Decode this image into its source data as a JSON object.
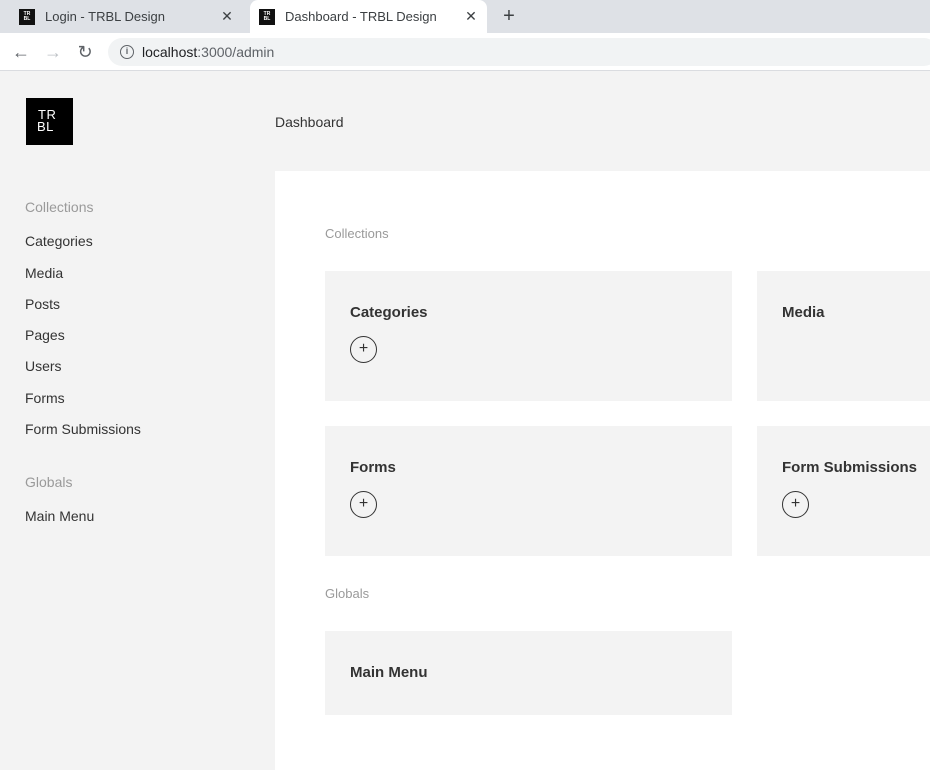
{
  "browser": {
    "tabs": [
      {
        "title": "Login - TRBL Design"
      },
      {
        "title": "Dashboard - TRBL Design"
      }
    ],
    "favicon_text": [
      "TR",
      "BL"
    ],
    "url_host": "localhost",
    "url_path": ":3000/admin"
  },
  "logo": {
    "line1": "TR",
    "line2": "BL"
  },
  "sidebar": {
    "collections_heading": "Collections",
    "collections": [
      "Categories",
      "Media",
      "Posts",
      "Pages",
      "Users",
      "Forms",
      "Form Submissions"
    ],
    "globals_heading": "Globals",
    "globals": [
      "Main Menu"
    ]
  },
  "header": {
    "breadcrumb": "Dashboard"
  },
  "main": {
    "collections_label": "Collections",
    "cards": [
      {
        "title": "Categories",
        "has_add": true
      },
      {
        "title": "Media",
        "has_add": false
      },
      {
        "title": "Forms",
        "has_add": true
      },
      {
        "title": "Form Submissions",
        "has_add": true
      }
    ],
    "globals_label": "Globals",
    "global_cards": [
      {
        "title": "Main Menu"
      }
    ],
    "add_symbol": "+"
  },
  "icons": {
    "back": "arrow-left-icon",
    "forward": "arrow-right-icon",
    "reload": "reload-icon",
    "info": "info-icon",
    "close": "close-icon",
    "new_tab": "plus-icon",
    "add": "plus-circle-icon"
  }
}
